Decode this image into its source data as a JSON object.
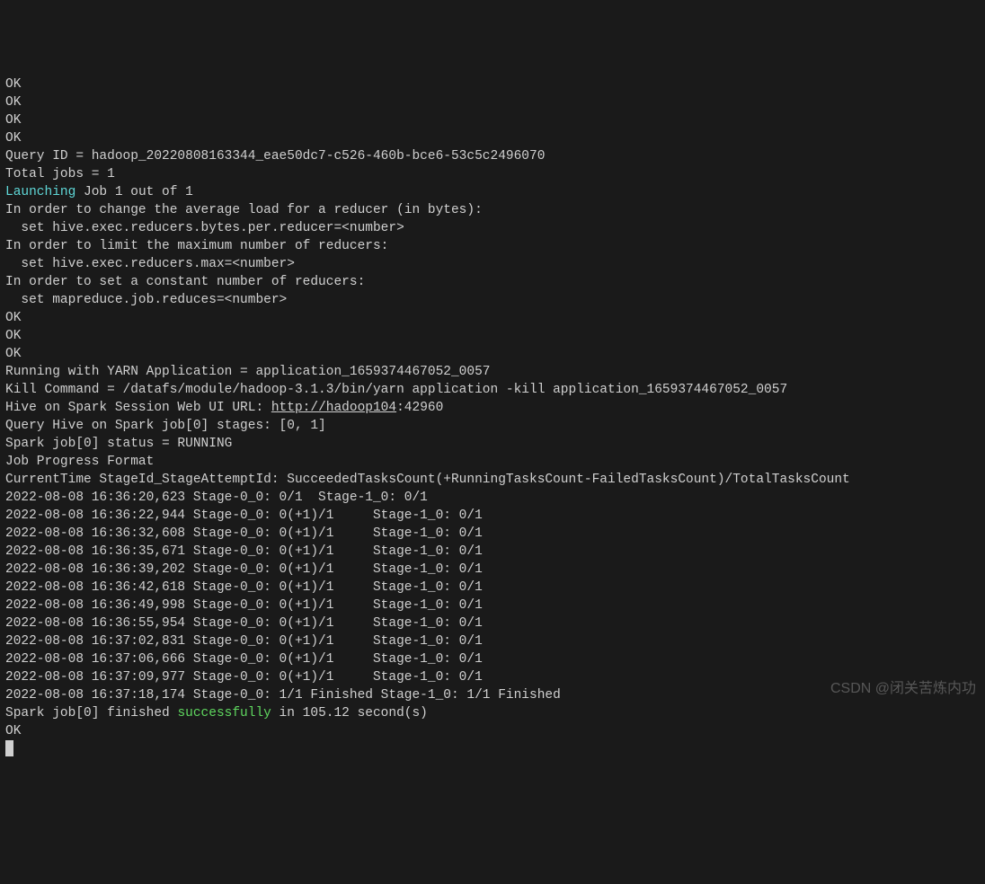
{
  "lines": {
    "ok1": "OK",
    "ok2": "OK",
    "ok3": "OK",
    "ok4": "OK",
    "queryId": "Query ID = hadoop_20220808163344_eae50dc7-c526-460b-bce6-53c5c2496070",
    "totalJobs": "Total jobs = 1",
    "launching": "Launching",
    "launchingRest": " Job 1 out of 1",
    "change1": "In order to change the average load for a reducer (in bytes):",
    "change2": "  set hive.exec.reducers.bytes.per.reducer=<number>",
    "limit1": "In order to limit the maximum number of reducers:",
    "limit2": "  set hive.exec.reducers.max=<number>",
    "const1": "In order to set a constant number of reducers:",
    "const2": "  set mapreduce.job.reduces=<number>",
    "ok5": "OK",
    "ok6": "OK",
    "ok7": "OK",
    "yarnApp": "Running with YARN Application = application_1659374467052_0057",
    "killCmd": "Kill Command = /datafs/module/hadoop-3.1.3/bin/yarn application -kill application_1659374467052_0057",
    "webUiPre": "Hive on Spark Session Web UI URL: ",
    "webUiUrl": "http://hadoop104",
    "webUiPort": ":42960",
    "blank1": "",
    "queryStages": "Query Hive on Spark job[0] stages: [0, 1]",
    "sparkStatus": "Spark job[0] status = RUNNING",
    "jobProgress": "Job Progress Format",
    "curTime": "CurrentTime StageId_StageAttemptId: SucceededTasksCount(+RunningTasksCount-FailedTasksCount)/TotalTasksCount",
    "p1": "2022-08-08 16:36:20,623 Stage-0_0: 0/1  Stage-1_0: 0/1",
    "p2": "2022-08-08 16:36:22,944 Stage-0_0: 0(+1)/1     Stage-1_0: 0/1",
    "p3": "2022-08-08 16:36:32,608 Stage-0_0: 0(+1)/1     Stage-1_0: 0/1",
    "p4": "2022-08-08 16:36:35,671 Stage-0_0: 0(+1)/1     Stage-1_0: 0/1",
    "p5": "2022-08-08 16:36:39,202 Stage-0_0: 0(+1)/1     Stage-1_0: 0/1",
    "p6": "2022-08-08 16:36:42,618 Stage-0_0: 0(+1)/1     Stage-1_0: 0/1",
    "p7": "2022-08-08 16:36:49,998 Stage-0_0: 0(+1)/1     Stage-1_0: 0/1",
    "p8": "2022-08-08 16:36:55,954 Stage-0_0: 0(+1)/1     Stage-1_0: 0/1",
    "p9": "2022-08-08 16:37:02,831 Stage-0_0: 0(+1)/1     Stage-1_0: 0/1",
    "p10": "2022-08-08 16:37:06,666 Stage-0_0: 0(+1)/1     Stage-1_0: 0/1",
    "p11": "2022-08-08 16:37:09,977 Stage-0_0: 0(+1)/1     Stage-1_0: 0/1",
    "p12": "2022-08-08 16:37:18,174 Stage-0_0: 1/1 Finished Stage-1_0: 1/1 Finished",
    "finishedPre": "Spark job[0] finished ",
    "successfully": "successfully",
    "finishedPost": " in 105.12 second(s)",
    "ok8": "OK"
  },
  "watermark": "CSDN @闭关苦炼内功"
}
